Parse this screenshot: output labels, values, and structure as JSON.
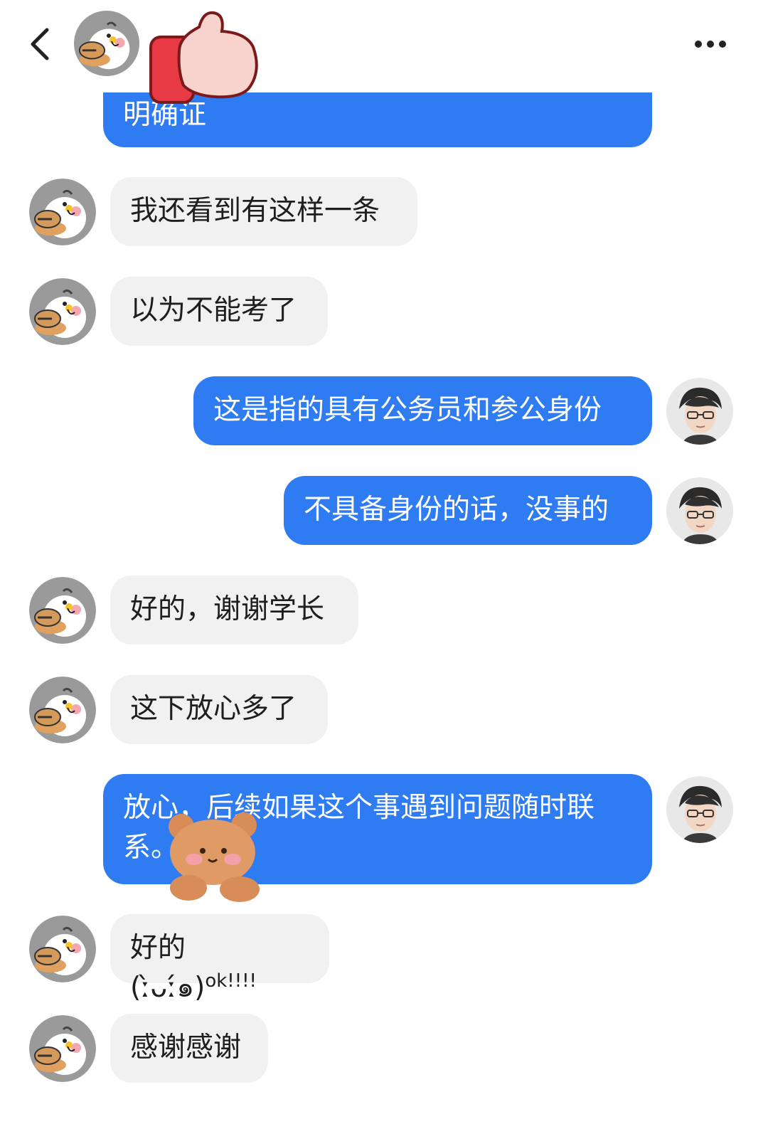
{
  "header": {
    "contact_name": "",
    "back_icon": "chevron-left-icon",
    "more_icon": "more-horizontal-icon"
  },
  "messages": [
    {
      "side": "out",
      "text": "明确证",
      "clipped": true
    },
    {
      "side": "in",
      "text": "我还看到有这样一条"
    },
    {
      "side": "in",
      "text": "以为不能考了"
    },
    {
      "side": "out",
      "text": "这是指的具有公务员和参公身份"
    },
    {
      "side": "out",
      "text": "不具备身份的话，没事的"
    },
    {
      "side": "in",
      "text": "好的，谢谢学长"
    },
    {
      "side": "in",
      "text": "这下放心多了"
    },
    {
      "side": "out",
      "line1": "放心，后续如果这个事遇到问题随时联",
      "line2": "系。"
    },
    {
      "side": "in",
      "text": "好的 (ː̀ᴗː́๑)",
      "sup": "ok!!!!"
    },
    {
      "side": "in",
      "text": "感谢感谢"
    }
  ],
  "colors": {
    "outgoing_bubble": "#2f7cf2",
    "incoming_bubble": "#f1f1f1",
    "background": "#ffffff"
  }
}
